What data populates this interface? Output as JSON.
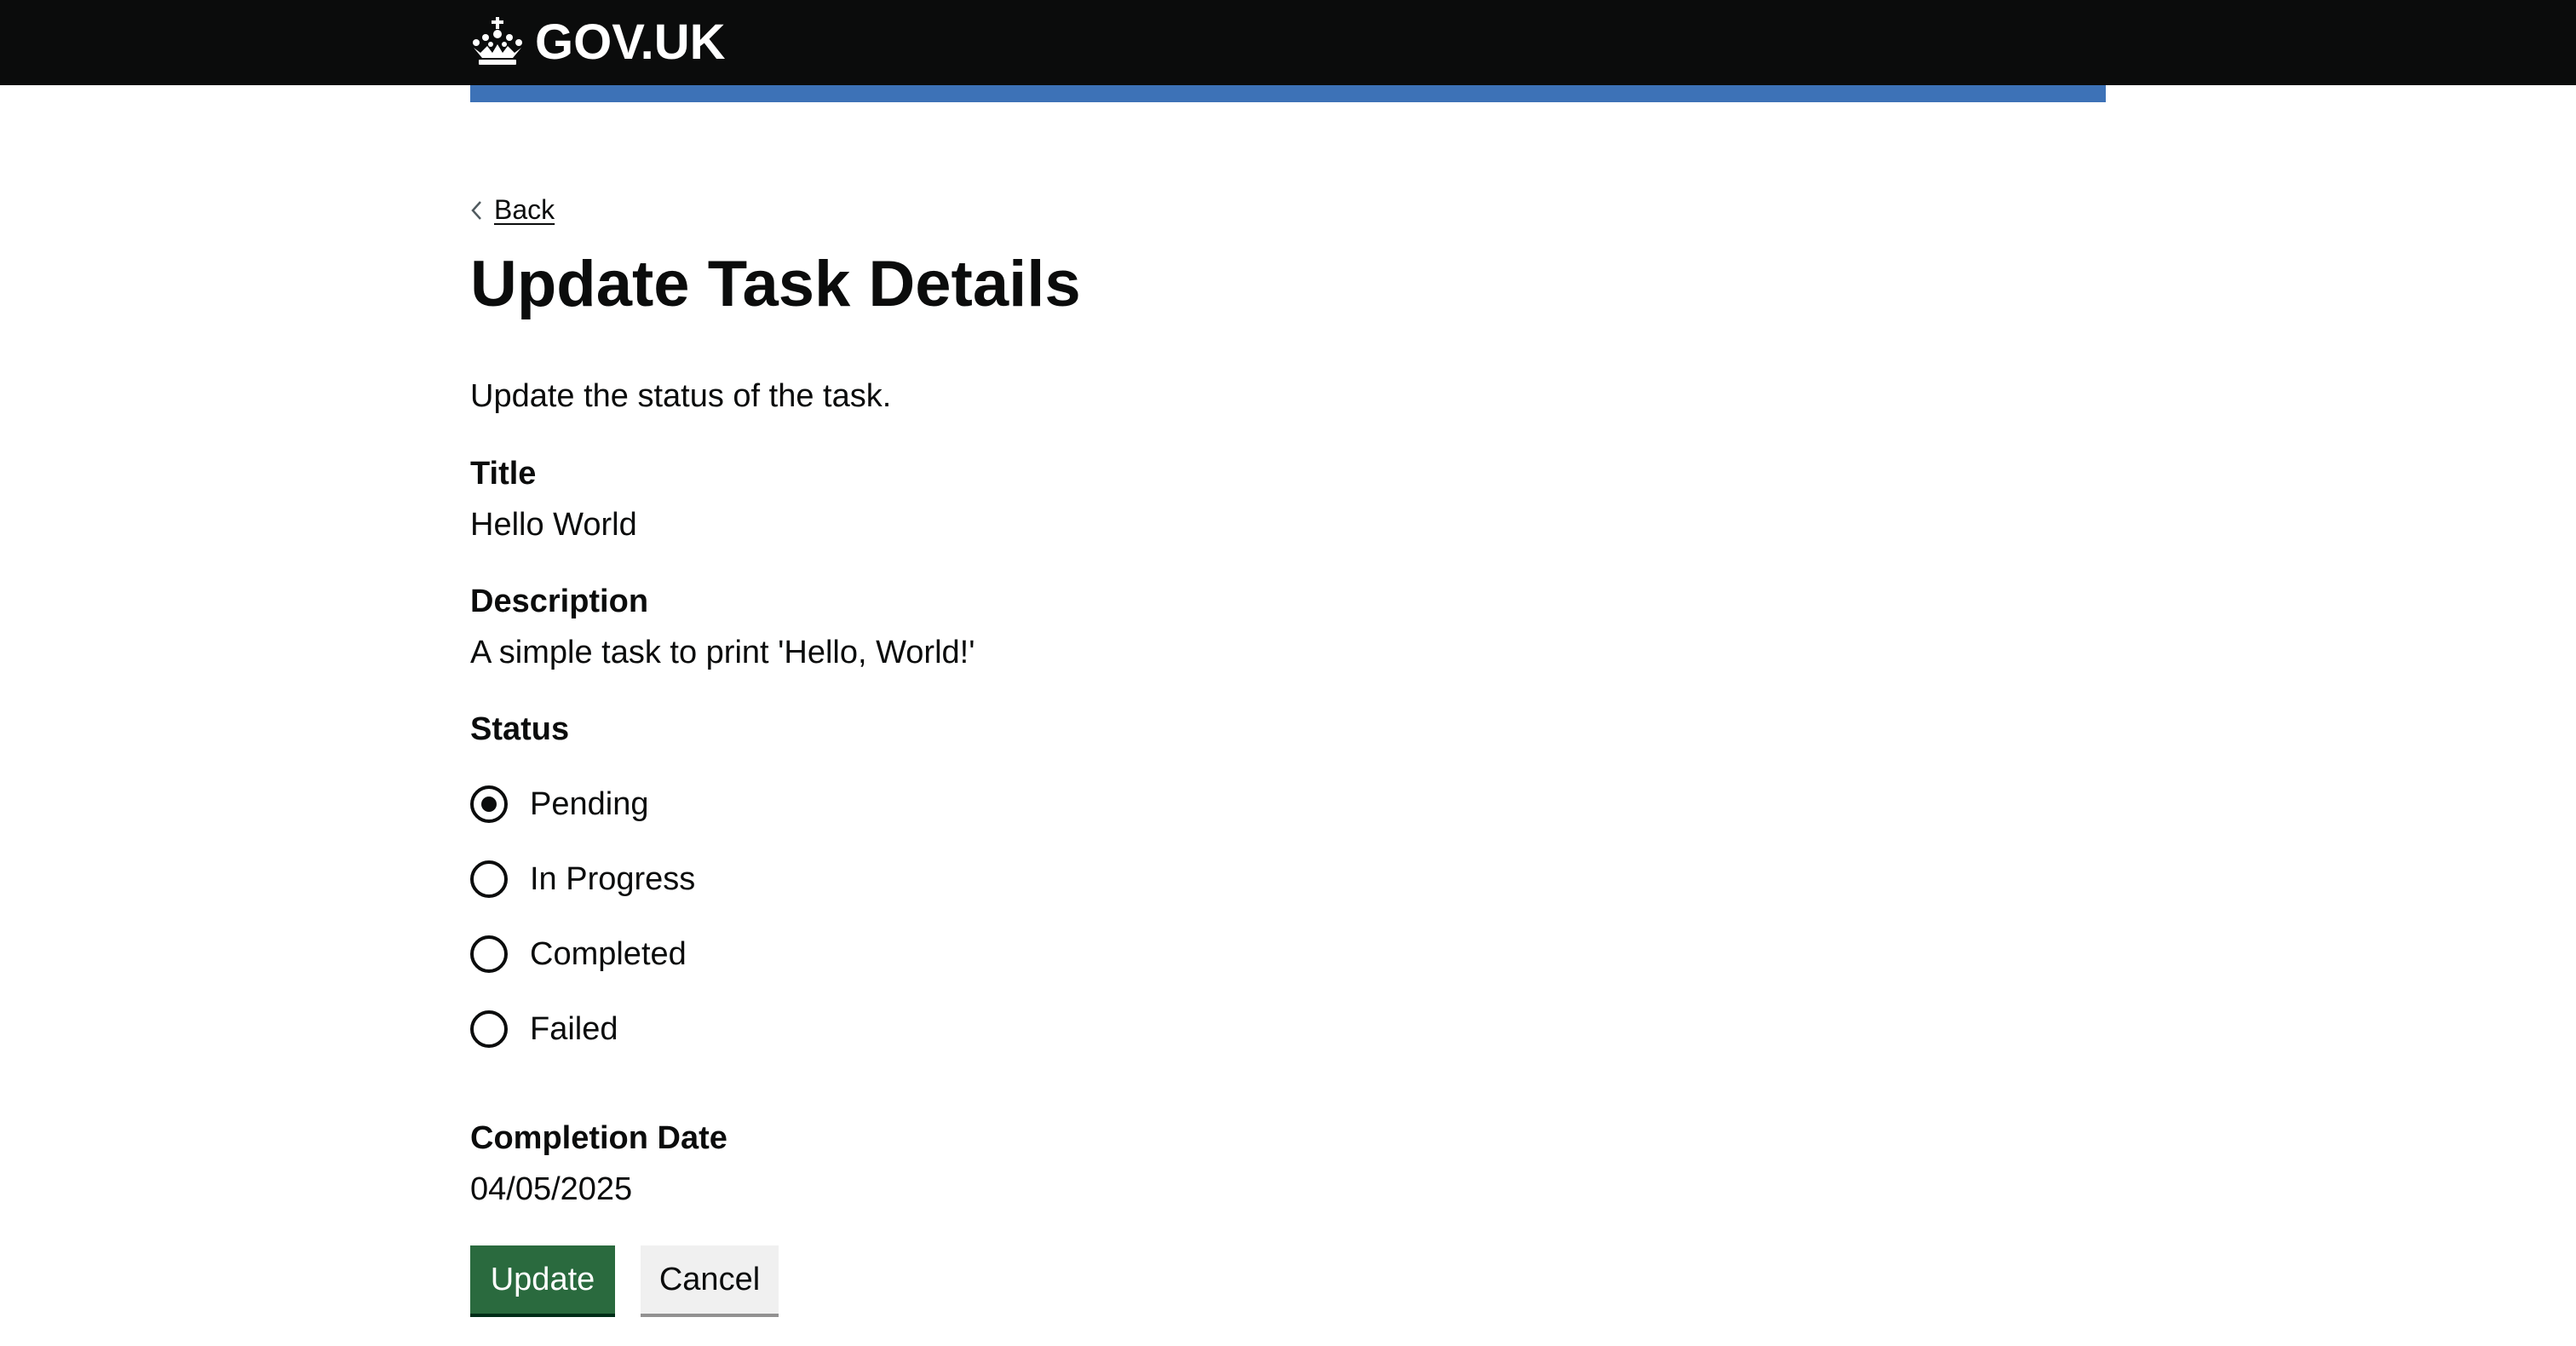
{
  "header": {
    "logo_text": "GOV.UK",
    "logo_icon": "crown-icon",
    "accent_color": "#3d72b7"
  },
  "back": {
    "label": "Back",
    "icon": "chevron-left-icon"
  },
  "page": {
    "title": "Update Task Details",
    "lead": "Update the status of the task."
  },
  "fields": {
    "title_label": "Title",
    "title_value": "Hello World",
    "description_label": "Description",
    "description_value": "A simple task to print 'Hello, World!'",
    "status_label": "Status",
    "completion_label": "Completion Date",
    "completion_value": "04/05/2025"
  },
  "status_options": [
    {
      "label": "Pending",
      "checked": true
    },
    {
      "label": "In Progress",
      "checked": false
    },
    {
      "label": "Completed",
      "checked": false
    },
    {
      "label": "Failed",
      "checked": false
    }
  ],
  "actions": {
    "update_label": "Update",
    "cancel_label": "Cancel",
    "update_color": "#2a6a3e"
  }
}
